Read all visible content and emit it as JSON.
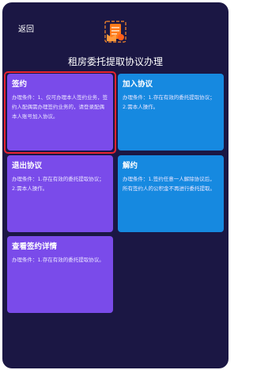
{
  "header": {
    "back_label": "返回",
    "title": "租房委托提取协议办理"
  },
  "icons": {
    "logo": "contract-document-icon"
  },
  "colors": {
    "background": "#1b1744",
    "card_purple": "#7a4bea",
    "card_blue": "#1689e0",
    "highlight": "#e8242e"
  },
  "cards": [
    {
      "title": "签约",
      "desc": "办理条件：1、仅可办理本人签约业务，签约人配偶需办理签约业务的，请登录配偶本人账号加入协议。",
      "selected": true
    },
    {
      "title": "加入协议",
      "desc": "办理条件：1.存在有效的委托提取协议；2.需本人操作。"
    },
    {
      "title": "退出协议",
      "desc": "办理条件：1.存在有效的委托提取协议；2.需本人操作。"
    },
    {
      "title": "解约",
      "desc": "办理条件：1.签约任意一人解除协议后，所有签约人的公积金不再进行委托提取。"
    },
    {
      "title": "查看签约详情",
      "desc": "办理条件：1.存在有效的委托提取协议。"
    }
  ]
}
